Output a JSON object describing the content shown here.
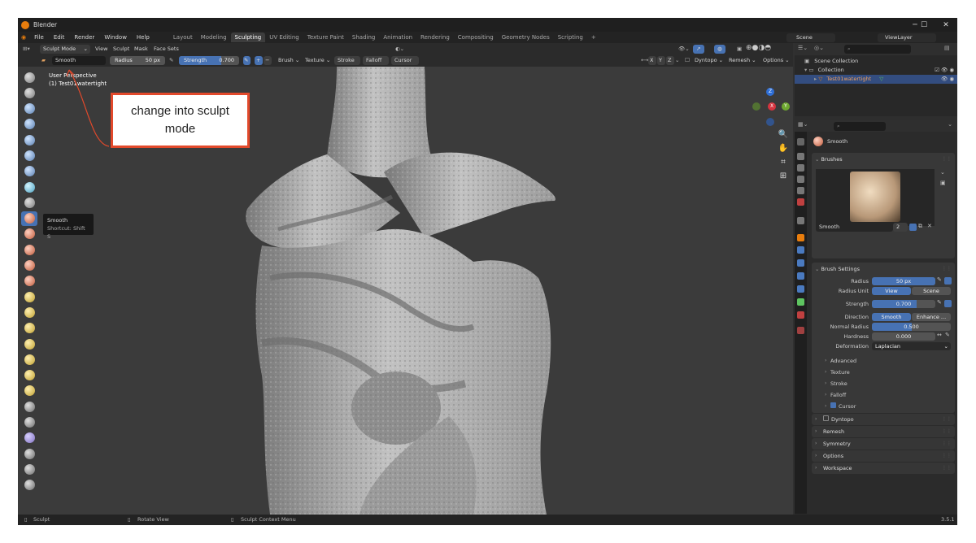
{
  "window": {
    "title": "Blender",
    "minimize": "─",
    "maximize": "☐",
    "close": "✕"
  },
  "menu": [
    "File",
    "Edit",
    "Render",
    "Window",
    "Help"
  ],
  "workspaces": [
    "Layout",
    "Modeling",
    "Sculpting",
    "UV Editing",
    "Texture Paint",
    "Shading",
    "Animation",
    "Rendering",
    "Compositing",
    "Geometry Nodes",
    "Scripting",
    "+"
  ],
  "active_workspace": "Sculpting",
  "scene": {
    "scene_name": "Scene",
    "view_layer": "ViewLayer"
  },
  "header": {
    "mode": "Sculpt Mode",
    "view": "View",
    "sculpt": "Sculpt",
    "mask": "Mask",
    "face_sets": "Face Sets"
  },
  "tool_header": {
    "brush": "Smooth",
    "radius_label": "Radius",
    "radius_value": "50 px",
    "strength_label": "Strength",
    "strength_value": "0.700",
    "brush_menu": "Brush",
    "texture_menu": "Texture",
    "stroke_menu": "Stroke",
    "falloff_menu": "Falloff",
    "cursor_menu": "Cursor",
    "x": "X",
    "y": "Y",
    "z": "Z",
    "dyntopo": "Dyntopo",
    "remesh": "Remesh",
    "options": "Options"
  },
  "viewport": {
    "perspective": "User Perspective",
    "object": "(1) Test01watertight"
  },
  "tooltip": {
    "title": "Smooth",
    "shortcut": "Shortcut: Shift S"
  },
  "annotation": {
    "text": "change into sculpt mode",
    "color": "#e2492b"
  },
  "gizmo": {
    "z": "Z",
    "y": "Y",
    "x": "X"
  },
  "status_bar": {
    "left": "Sculpt",
    "middle": "Rotate View",
    "context": "Sculpt Context Menu",
    "version": "3.5.1"
  },
  "outliner": {
    "scene_collection": "Scene Collection",
    "collection": "Collection",
    "object": "Test01watertight"
  },
  "properties": {
    "brush_name": "Smooth",
    "brushes_panel": "Brushes",
    "brush_field": "Smooth",
    "brush_users": "2",
    "brush_settings": "Brush Settings",
    "rows": {
      "radius_label": "Radius",
      "radius_value": "50 px",
      "radius_unit_label": "Radius Unit",
      "view_option": "View",
      "scene_option": "Scene",
      "strength_label": "Strength",
      "strength_value": "0.700",
      "direction_label": "Direction",
      "smooth_option": "Smooth",
      "enhance_option": "Enhance ...",
      "normal_radius_label": "Normal Radius",
      "normal_radius_value": "0.500",
      "hardness_label": "Hardness",
      "hardness_value": "0.000",
      "deformation_label": "Deformation",
      "deformation_value": "Laplacian"
    },
    "subpanels": [
      "Advanced",
      "Texture",
      "Stroke",
      "Falloff",
      "Cursor"
    ],
    "panels": [
      "Dyntopo",
      "Remesh",
      "Symmetry",
      "Options",
      "Workspace"
    ],
    "radius_fill": 1.0,
    "strength_fill": 0.7,
    "normal_radius_fill": 0.5,
    "hardness_fill": 0.0
  },
  "colors": {
    "accent": "#4772b3",
    "annotation": "#e2492b",
    "orange": "#e87d0d"
  }
}
